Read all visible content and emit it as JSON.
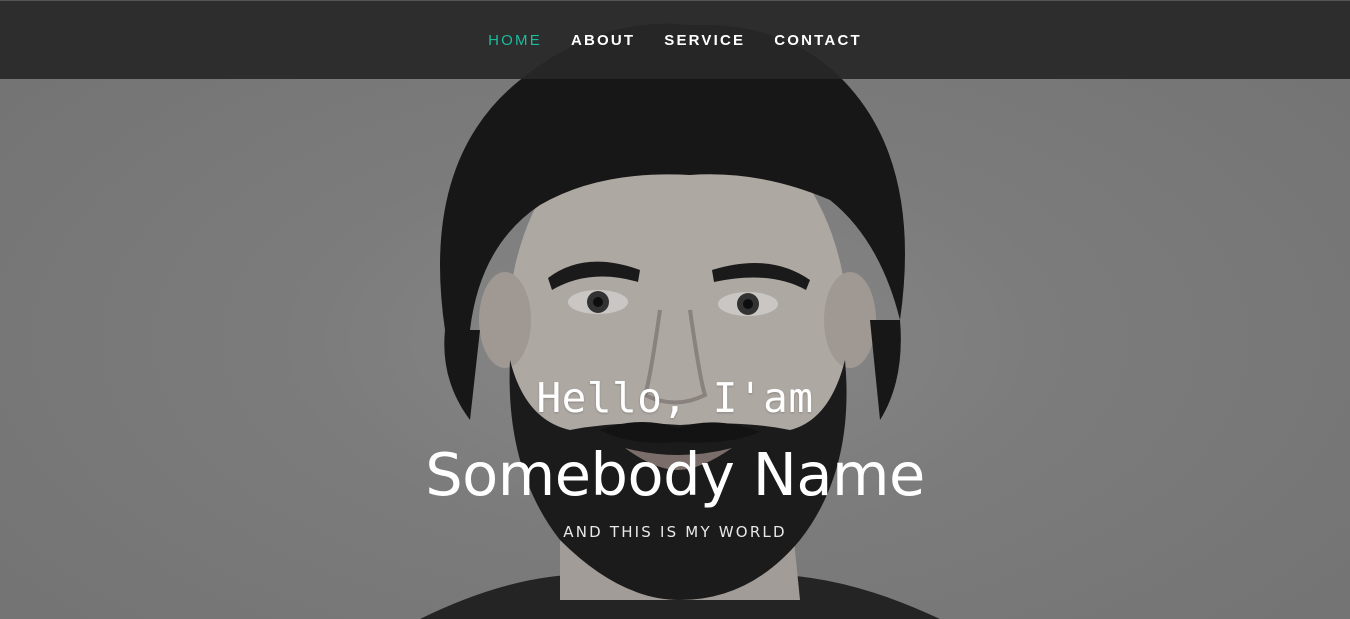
{
  "nav": {
    "items": [
      {
        "label": "HOME",
        "active": true
      },
      {
        "label": "ABOUT",
        "active": false
      },
      {
        "label": "SERVICE",
        "active": false
      },
      {
        "label": "CONTACT",
        "active": false
      }
    ],
    "active_color": "#1abc9c"
  },
  "hero": {
    "greeting": "Hello, I'am",
    "name": "Somebody Name",
    "tagline": "AND THIS IS MY WORLD"
  }
}
